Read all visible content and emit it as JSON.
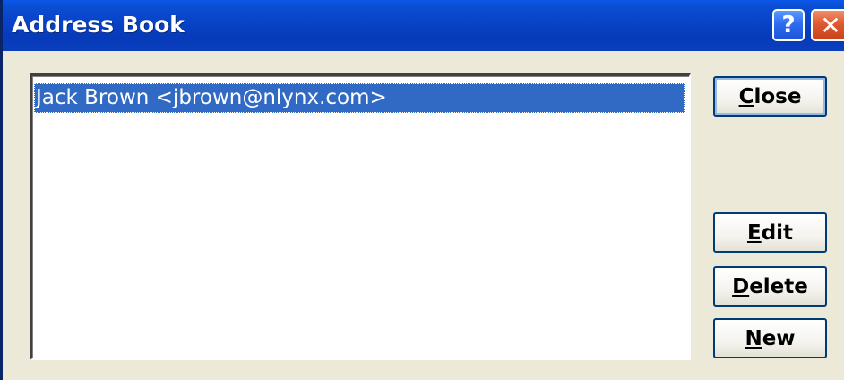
{
  "window": {
    "title": "Address Book",
    "help_glyph": "?",
    "close_glyph": "✕"
  },
  "contacts": {
    "items": [
      {
        "label": "Jack Brown <jbrown@nlynx.com>",
        "selected": true
      }
    ]
  },
  "buttons": {
    "close": {
      "accel": "C",
      "rest": "lose"
    },
    "edit": {
      "accel": "E",
      "rest": "dit"
    },
    "delete": {
      "accel": "D",
      "rest": "elete"
    },
    "new": {
      "accel": "N",
      "rest": "ew"
    }
  },
  "colors": {
    "titlebar": "#0a4ed4",
    "selection": "#316ac5",
    "dialog_background": "#ece9d8",
    "close_button": "#e05a30",
    "help_button": "#2e6cf0"
  }
}
